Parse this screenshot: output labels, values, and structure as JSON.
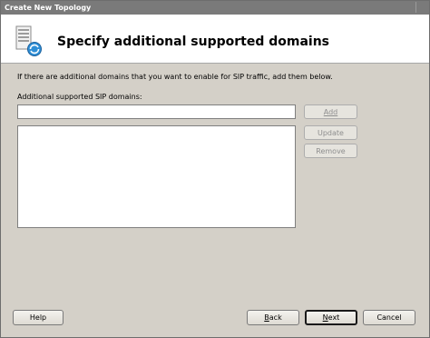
{
  "window": {
    "title": "Create New Topology"
  },
  "header": {
    "title": "Specify additional supported domains"
  },
  "content": {
    "instruction": "If there are additional domains that you want to enable for SIP traffic, add them below.",
    "domains_label": "Additional supported SIP domains:",
    "domain_input": {
      "value": "",
      "placeholder": ""
    },
    "domains": []
  },
  "side_buttons": {
    "add": "Add",
    "update": "Update",
    "remove": "Remove"
  },
  "footer": {
    "help": "Help",
    "back_first": "B",
    "back_rest": "ack",
    "next_first": "N",
    "next_rest": "ext",
    "cancel": "Cancel"
  },
  "colors": {
    "titlebar": "#7a7a7a",
    "dialog_bg": "#d4d0c8",
    "header_bg": "#ffffff",
    "icon_accent": "#2f8fd6"
  }
}
